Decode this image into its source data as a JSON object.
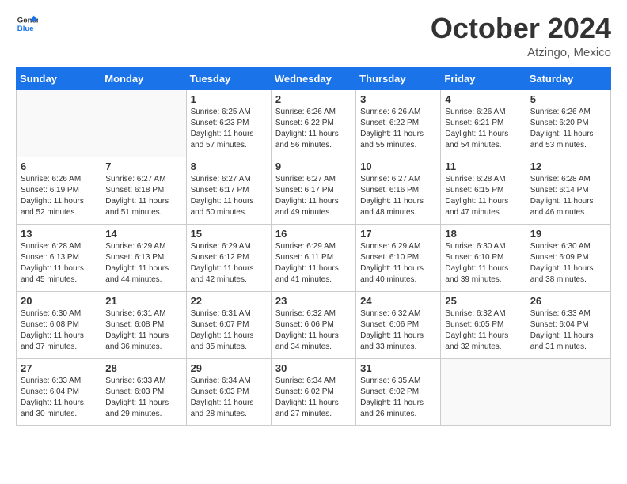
{
  "header": {
    "logo_line1": "General",
    "logo_line2": "Blue",
    "month": "October 2024",
    "location": "Atzingo, Mexico"
  },
  "weekdays": [
    "Sunday",
    "Monday",
    "Tuesday",
    "Wednesday",
    "Thursday",
    "Friday",
    "Saturday"
  ],
  "weeks": [
    [
      {
        "day": "",
        "info": ""
      },
      {
        "day": "",
        "info": ""
      },
      {
        "day": "1",
        "info": "Sunrise: 6:25 AM\nSunset: 6:23 PM\nDaylight: 11 hours and 57 minutes."
      },
      {
        "day": "2",
        "info": "Sunrise: 6:26 AM\nSunset: 6:22 PM\nDaylight: 11 hours and 56 minutes."
      },
      {
        "day": "3",
        "info": "Sunrise: 6:26 AM\nSunset: 6:22 PM\nDaylight: 11 hours and 55 minutes."
      },
      {
        "day": "4",
        "info": "Sunrise: 6:26 AM\nSunset: 6:21 PM\nDaylight: 11 hours and 54 minutes."
      },
      {
        "day": "5",
        "info": "Sunrise: 6:26 AM\nSunset: 6:20 PM\nDaylight: 11 hours and 53 minutes."
      }
    ],
    [
      {
        "day": "6",
        "info": "Sunrise: 6:26 AM\nSunset: 6:19 PM\nDaylight: 11 hours and 52 minutes."
      },
      {
        "day": "7",
        "info": "Sunrise: 6:27 AM\nSunset: 6:18 PM\nDaylight: 11 hours and 51 minutes."
      },
      {
        "day": "8",
        "info": "Sunrise: 6:27 AM\nSunset: 6:17 PM\nDaylight: 11 hours and 50 minutes."
      },
      {
        "day": "9",
        "info": "Sunrise: 6:27 AM\nSunset: 6:17 PM\nDaylight: 11 hours and 49 minutes."
      },
      {
        "day": "10",
        "info": "Sunrise: 6:27 AM\nSunset: 6:16 PM\nDaylight: 11 hours and 48 minutes."
      },
      {
        "day": "11",
        "info": "Sunrise: 6:28 AM\nSunset: 6:15 PM\nDaylight: 11 hours and 47 minutes."
      },
      {
        "day": "12",
        "info": "Sunrise: 6:28 AM\nSunset: 6:14 PM\nDaylight: 11 hours and 46 minutes."
      }
    ],
    [
      {
        "day": "13",
        "info": "Sunrise: 6:28 AM\nSunset: 6:13 PM\nDaylight: 11 hours and 45 minutes."
      },
      {
        "day": "14",
        "info": "Sunrise: 6:29 AM\nSunset: 6:13 PM\nDaylight: 11 hours and 44 minutes."
      },
      {
        "day": "15",
        "info": "Sunrise: 6:29 AM\nSunset: 6:12 PM\nDaylight: 11 hours and 42 minutes."
      },
      {
        "day": "16",
        "info": "Sunrise: 6:29 AM\nSunset: 6:11 PM\nDaylight: 11 hours and 41 minutes."
      },
      {
        "day": "17",
        "info": "Sunrise: 6:29 AM\nSunset: 6:10 PM\nDaylight: 11 hours and 40 minutes."
      },
      {
        "day": "18",
        "info": "Sunrise: 6:30 AM\nSunset: 6:10 PM\nDaylight: 11 hours and 39 minutes."
      },
      {
        "day": "19",
        "info": "Sunrise: 6:30 AM\nSunset: 6:09 PM\nDaylight: 11 hours and 38 minutes."
      }
    ],
    [
      {
        "day": "20",
        "info": "Sunrise: 6:30 AM\nSunset: 6:08 PM\nDaylight: 11 hours and 37 minutes."
      },
      {
        "day": "21",
        "info": "Sunrise: 6:31 AM\nSunset: 6:08 PM\nDaylight: 11 hours and 36 minutes."
      },
      {
        "day": "22",
        "info": "Sunrise: 6:31 AM\nSunset: 6:07 PM\nDaylight: 11 hours and 35 minutes."
      },
      {
        "day": "23",
        "info": "Sunrise: 6:32 AM\nSunset: 6:06 PM\nDaylight: 11 hours and 34 minutes."
      },
      {
        "day": "24",
        "info": "Sunrise: 6:32 AM\nSunset: 6:06 PM\nDaylight: 11 hours and 33 minutes."
      },
      {
        "day": "25",
        "info": "Sunrise: 6:32 AM\nSunset: 6:05 PM\nDaylight: 11 hours and 32 minutes."
      },
      {
        "day": "26",
        "info": "Sunrise: 6:33 AM\nSunset: 6:04 PM\nDaylight: 11 hours and 31 minutes."
      }
    ],
    [
      {
        "day": "27",
        "info": "Sunrise: 6:33 AM\nSunset: 6:04 PM\nDaylight: 11 hours and 30 minutes."
      },
      {
        "day": "28",
        "info": "Sunrise: 6:33 AM\nSunset: 6:03 PM\nDaylight: 11 hours and 29 minutes."
      },
      {
        "day": "29",
        "info": "Sunrise: 6:34 AM\nSunset: 6:03 PM\nDaylight: 11 hours and 28 minutes."
      },
      {
        "day": "30",
        "info": "Sunrise: 6:34 AM\nSunset: 6:02 PM\nDaylight: 11 hours and 27 minutes."
      },
      {
        "day": "31",
        "info": "Sunrise: 6:35 AM\nSunset: 6:02 PM\nDaylight: 11 hours and 26 minutes."
      },
      {
        "day": "",
        "info": ""
      },
      {
        "day": "",
        "info": ""
      }
    ]
  ]
}
